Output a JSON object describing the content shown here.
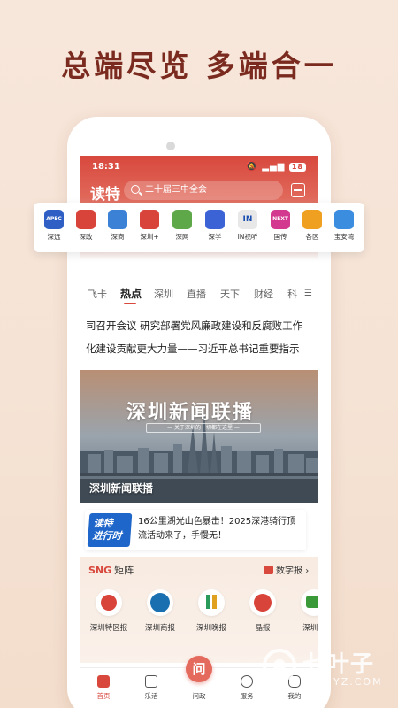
{
  "promo_headline": "总端尽览 多端合一",
  "status": {
    "time": "18:31",
    "battery": "18"
  },
  "header": {
    "logo": "读特",
    "search_placeholder": "二十届三中全会"
  },
  "quick_apps": [
    {
      "label": "深远",
      "icon": "apec-shenzhen-icon",
      "icon_text": "APEC 深圳",
      "color": "#2f5fc4"
    },
    {
      "label": "深政",
      "icon": "shenzhen-gov-icon",
      "icon_text": "",
      "color": "#d8433a"
    },
    {
      "label": "深商",
      "icon": "shenzhen-business-icon",
      "icon_text": "",
      "color": "#3b82d6"
    },
    {
      "label": "深圳+",
      "icon": "shenzhen-plus-icon",
      "icon_text": "",
      "color": "#d8433a"
    },
    {
      "label": "深网",
      "icon": "shenzhen-net-icon",
      "icon_text": "",
      "color": "#5fa84a"
    },
    {
      "label": "深学",
      "icon": "graduation-cap-icon",
      "icon_text": "",
      "color": "#3b63d6"
    },
    {
      "label": "IN视听",
      "icon": "in-video-icon",
      "icon_text": "IN",
      "color": "#e8e8e8"
    },
    {
      "label": "国传",
      "icon": "next-icon",
      "icon_text": "NEXT",
      "color": "#d33a8f"
    },
    {
      "label": "各区",
      "icon": "location-pin-icon",
      "icon_text": "",
      "color": "#f0a020"
    },
    {
      "label": "宝安湾",
      "icon": "baoan-bay-icon",
      "icon_text": "",
      "color": "#3b8de0"
    }
  ],
  "tabs": [
    "飞卡",
    "热点",
    "深圳",
    "直播",
    "天下",
    "财经",
    "科"
  ],
  "active_tab": "热点",
  "headlines": [
    "司召开会议 研究部署党风廉政建设和反腐败工作",
    "化建设贡献更大力量——习近平总书记重要指示"
  ],
  "banner": {
    "title": "深圳新闻联播",
    "subtitle": "— 关于深圳的一切都在这里 —",
    "caption": "深圳新闻联播"
  },
  "promo_card": {
    "badge_line1": "读特",
    "badge_line2": "进行时",
    "text": "16公里湖光山色暴击！2025深港骑行顶流活动来了，手慢无！"
  },
  "matrix": {
    "brand": "SNG",
    "title": "矩阵",
    "digital_label": "数字报",
    "digital_chevron": "›",
    "papers": [
      {
        "label": "深圳特区报",
        "icon": "sz-special-zone-daily-icon",
        "color": "#d8433a"
      },
      {
        "label": "深圳商报",
        "icon": "sz-commercial-daily-icon",
        "color": "#1a6fb0"
      },
      {
        "label": "深圳晚报",
        "icon": "sz-evening-news-icon",
        "color": "#2a9a5a"
      },
      {
        "label": "晶报",
        "icon": "jing-daily-icon",
        "color": "#d8433a"
      },
      {
        "label": "深圳新",
        "icon": "sz-news-icon",
        "color": "#3a9a3a"
      }
    ]
  },
  "bottom_nav": [
    {
      "label": "首页",
      "icon": "home-icon",
      "active": true
    },
    {
      "label": "乐活",
      "icon": "basket-icon",
      "active": false
    },
    {
      "label": "问政",
      "icon": "ask-icon",
      "active": false,
      "glyph": "问"
    },
    {
      "label": "服务",
      "icon": "grid-services-icon",
      "active": false
    },
    {
      "label": "我的",
      "icon": "profile-icon",
      "active": false
    }
  ],
  "watermark": {
    "brand": "七叶子",
    "domain": "7YZ.COM"
  }
}
